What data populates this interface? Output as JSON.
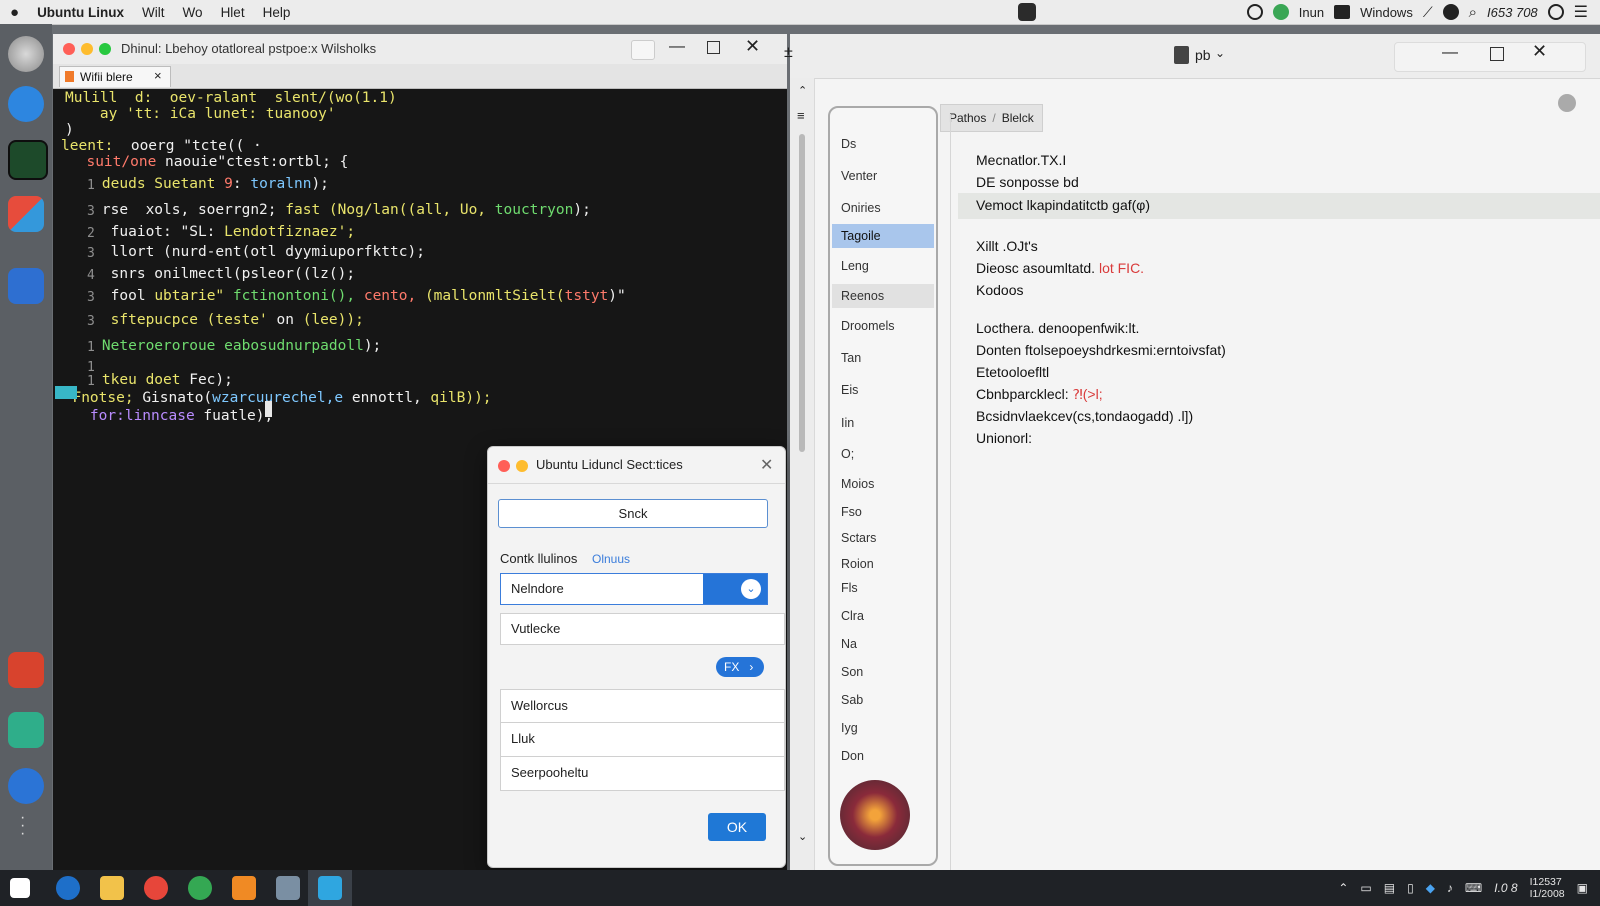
{
  "menubar": {
    "app_name": "Ubuntu Linux",
    "items": [
      "Wilt",
      "Wo",
      "Hlet",
      "Help"
    ],
    "right": {
      "user": "Inun",
      "windows": "Windows",
      "clock": "I653 708"
    }
  },
  "terminal": {
    "title": "Dhinul: Lbehoy otatloreal pstpoe:x Wilsholks",
    "tab_label": "Wifii blere",
    "code": [
      {
        "num": "",
        "segs": [
          [
            "Mulill  d:  oev-ralant  slent/(wo(1.1)",
            "#e9e46b"
          ]
        ]
      },
      {
        "num": "",
        "segs": [
          [
            "    ay 'tt: iCa lunet: tuanooy'",
            "#e9e46b"
          ]
        ]
      },
      {
        "num": "",
        "segs": [
          [
            ")",
            "#f0f0f0"
          ]
        ]
      },
      {
        "num": "",
        "segs": [
          [
            "leent:  ",
            "#e9e46b"
          ],
          [
            "ooerg \"tcte(( ·",
            "#f0f0f0"
          ]
        ]
      },
      {
        "num": "",
        "segs": [
          [
            "  suit/one ",
            "#ff7a6b"
          ],
          [
            "naouie\"ctest:ortbl; {",
            "#f0f0f0"
          ]
        ]
      },
      {
        "num": "1",
        "segs": [
          [
            "    deuds Suetant ",
            "#e9e46b"
          ],
          [
            "9",
            "#ff7a6b"
          ],
          [
            ": ",
            "#f0f0f0"
          ],
          [
            "toralnn",
            "#7ec8ff"
          ],
          [
            ");",
            "#f0f0f0"
          ]
        ]
      },
      {
        "num": "3",
        "segs": [
          [
            "    rse  xols, soerrgn2; ",
            "#f0f0f0"
          ],
          [
            "fast (Nog/lan((all, Uo, ",
            "#e9e46b"
          ],
          [
            "touctryon",
            "#6fdc6f"
          ],
          [
            ");",
            "#f0f0f0"
          ]
        ]
      },
      {
        "num": "2",
        "segs": [
          [
            "     fuaiot: \"SL: ",
            "#f0f0f0"
          ],
          [
            "Lendotfiznaez';",
            "#e9e46b"
          ]
        ]
      },
      {
        "num": "3",
        "segs": [
          [
            "     llort (nurd-ent(otl dyymiuporfkttc);",
            "#f0f0f0"
          ]
        ]
      },
      {
        "num": "4",
        "segs": [
          [
            "     snrs onilmectl(psleor((lz();",
            "#f0f0f0"
          ]
        ]
      },
      {
        "num": "3",
        "segs": [
          [
            "     fool ",
            "#f0f0f0"
          ],
          [
            "ubtarie\" ",
            "#e9e46b"
          ],
          [
            "fctinontoni(), ",
            "#6fdc6f"
          ],
          [
            "cento, ",
            "#ff7a6b"
          ],
          [
            "(mallonmltSielt(",
            "#e9e46b"
          ],
          [
            "tstyt",
            "#ff7a6b"
          ],
          [
            ")\"",
            "#f0f0f0"
          ]
        ]
      },
      {
        "num": "3",
        "segs": [
          [
            "     sftepucpce (teste' ",
            "#e9e46b"
          ],
          [
            "on ",
            "#f0f0f0"
          ],
          [
            "(lee));",
            "#e9e46b"
          ]
        ]
      },
      {
        "num": "1",
        "segs": [
          [
            "    Neteroeroroue eabosudnurpadoll",
            "#6fdc6f"
          ],
          [
            ");",
            "#f0f0f0"
          ]
        ]
      },
      {
        "num": "1",
        "segs": [
          [
            "",
            "#f0f0f0"
          ]
        ]
      },
      {
        "num": "1",
        "segs": [
          [
            "    tkeu doet ",
            "#e9e46b"
          ],
          [
            "Fec);",
            "#f0f0f0"
          ]
        ]
      },
      {
        "num": "",
        "segs": [
          [
            "  Fnotse; ",
            "#e9e46b"
          ],
          [
            "Gisnato(",
            "#f0f0f0"
          ],
          [
            "wzarcuurechel,e ",
            "#7ec8ff"
          ],
          [
            "ennottl, ",
            "#f0f0f0"
          ],
          [
            "qilB));",
            "#e9e46b"
          ]
        ]
      },
      {
        "num": "",
        "segs": [
          [
            "    for:linncase ",
            "#b98cff"
          ],
          [
            "fuatle), ",
            "#f0f0f0"
          ]
        ]
      }
    ]
  },
  "dialog": {
    "title": "Ubuntu Liduncl Sect:tices",
    "button_top": "Snck",
    "section_label": "Contk llulinos",
    "section_link": "Olnuus",
    "select_value": "Nelndore",
    "field_1": "Vutlecke",
    "pill_label": "FX",
    "list": [
      "Wellorcus",
      "Lluk",
      "Seerpooheltu"
    ],
    "ok_label": "OK"
  },
  "explorer": {
    "title_label": "pb",
    "breadcrumb": [
      "Pathos",
      "Blelck"
    ],
    "nav_items": [
      "Ds",
      "Venter",
      "Oniries",
      "Tagoile",
      "Leng",
      "Reenos",
      "Droomels",
      "Tan",
      "Eis",
      "Iin",
      "O;",
      "Moios",
      "Fso",
      "Sctars",
      "Roion",
      "Fls",
      "Clra",
      "Na",
      "Son",
      "Sab",
      "Iyg",
      "Don"
    ],
    "selected_nav": "Tagoile",
    "hover_nav": "Reenos",
    "content": [
      {
        "text": "Mecnatlor.TX.I",
        "highlight": false
      },
      {
        "text": "DE  sonposse bd",
        "highlight": false
      },
      {
        "text": "Vemoct  lkapindatitctb  gaf(φ)",
        "highlight": true
      },
      {
        "text": "Xillt .OJt's",
        "highlight": false
      },
      {
        "text": "Dieosc asoumltatd. ",
        "highlight": false,
        "accent": "lot  FIC."
      },
      {
        "text": "Kodoos",
        "highlight": false
      },
      {
        "text": "Locthera. denoopenfwik:lt.",
        "highlight": false
      },
      {
        "text": "Donten  ftolsepoeyshdrkesmi:erntoivsfat)",
        "highlight": false
      },
      {
        "text": "Etetooloefltl",
        "highlight": false
      },
      {
        "text": "Cbnbparcklecl:  ",
        "highlight": false,
        "accent": "⁈(>l;"
      },
      {
        "text": "Bcsidnvlaekcev(cs,tondaogadd)  .l])",
        "highlight": false
      },
      {
        "text": "Unionorl:",
        "highlight": false
      }
    ]
  },
  "taskbar": {
    "clock_time": "I12537",
    "clock_date": "I1/2008"
  }
}
